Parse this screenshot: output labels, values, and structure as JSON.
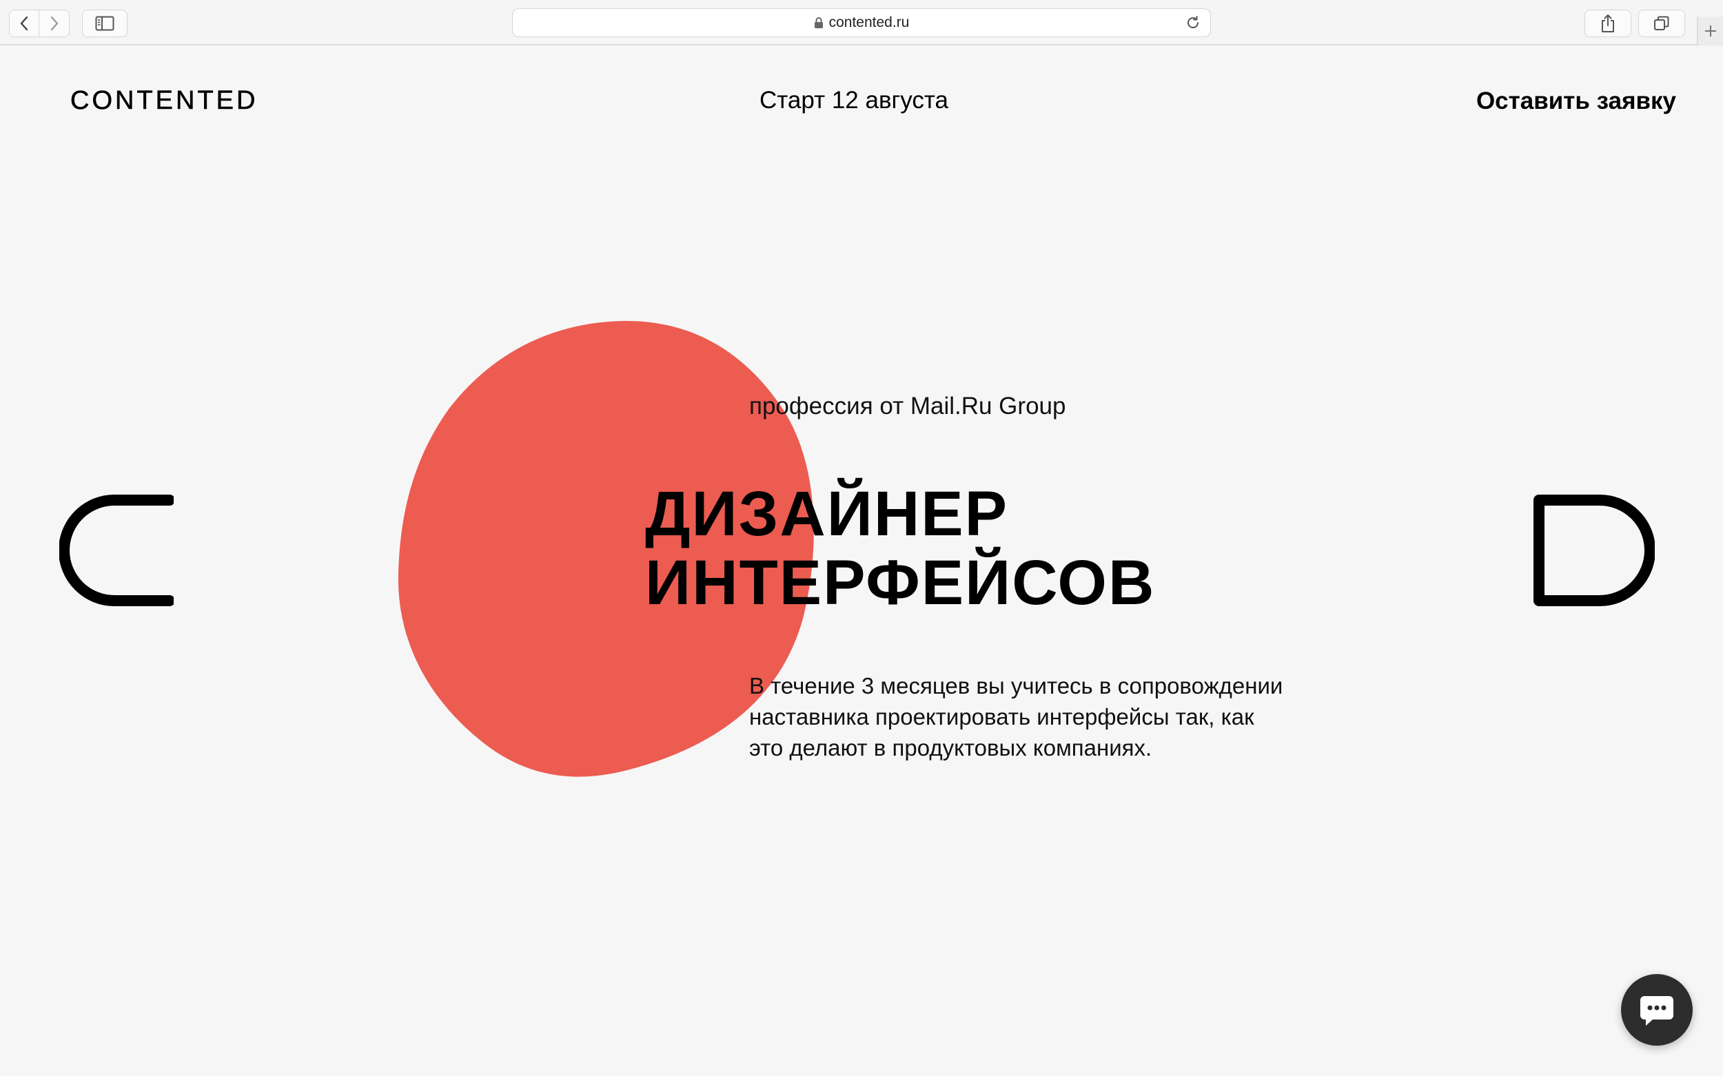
{
  "browser": {
    "url": "contented.ru"
  },
  "header": {
    "logo": "CONTENTED",
    "start_date": "Старт 12 августа",
    "cta_label": "Оставить заявку"
  },
  "hero": {
    "subtitle": "профессия от Mail.Ru Group",
    "title_line1": "ДИЗАЙНЕР",
    "title_line2": "ИНТЕРФЕЙСОВ",
    "description_line1": "В течение 3 месяцев вы учитесь в сопровождении",
    "description_line2": "наставника проектировать интерфейсы так, как",
    "description_line3": "это делают в продуктовых компаниях.",
    "blob_color": "#ec5c51"
  },
  "decor": {
    "left_letter": "C",
    "right_letter": "D"
  },
  "icons": {
    "back": "chevron-left-icon",
    "forward": "chevron-right-icon",
    "sidebar": "sidebar-icon",
    "lock": "lock-icon",
    "reload": "reload-icon",
    "share": "share-icon",
    "tabs": "tabs-icon",
    "new_tab": "plus-icon",
    "chat": "chat-bubble-icon"
  }
}
